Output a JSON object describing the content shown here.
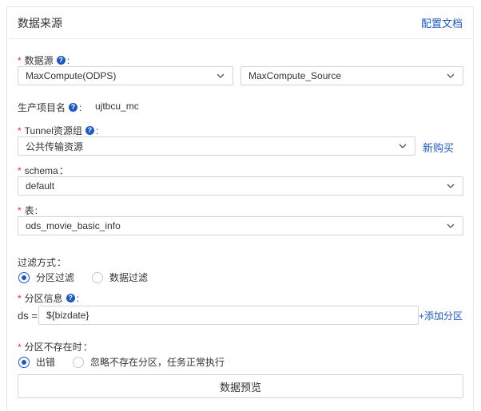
{
  "header": {
    "title": "数据来源",
    "doc_link": "配置文档"
  },
  "datasource": {
    "label": "数据源",
    "type_value": "MaxCompute(ODPS)",
    "source_value": "MaxCompute_Source"
  },
  "project": {
    "label": "生产项目名",
    "value": "ujtbcu_mc"
  },
  "tunnel": {
    "label": "Tunnel资源组",
    "value": "公共传输资源",
    "buy_link": "新购买"
  },
  "schema": {
    "label": "schema",
    "value": "default"
  },
  "table": {
    "label": "表",
    "value": "ods_movie_basic_info"
  },
  "filter": {
    "label": "过滤方式",
    "options": [
      "分区过滤",
      "数据过滤"
    ],
    "selected_index": 0
  },
  "partition": {
    "label": "分区信息",
    "key": "ds =",
    "value": "${bizdate}",
    "add_link": "+添加分区"
  },
  "missing": {
    "label": "分区不存在时",
    "options": [
      "出错",
      "忽略不存在分区，任务正常执行"
    ],
    "selected_index": 0
  },
  "preview_button": "数据预览",
  "colors": {
    "accent": "#1b58c4",
    "required": "#e5302c",
    "border": "#d5d5d5"
  },
  "icons": {
    "help": "help-circle-icon",
    "dropdown": "chevron-down-icon"
  }
}
